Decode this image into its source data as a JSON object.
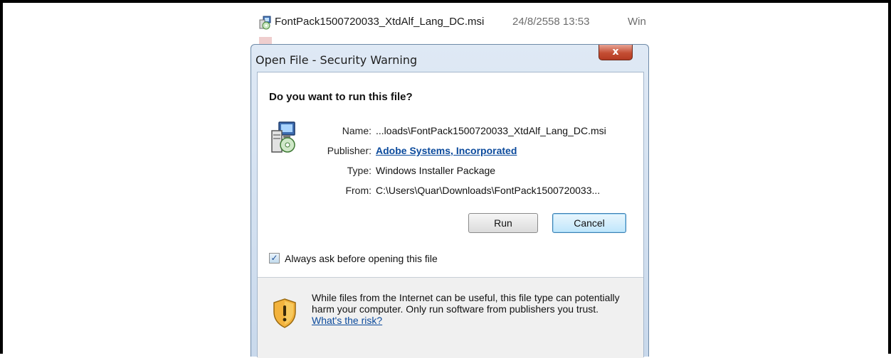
{
  "background_file": {
    "name": "FontPack1500720033_XtdAlf_Lang_DC.msi",
    "date": "24/8/2558 13:53",
    "type": "Win"
  },
  "dialog": {
    "title": "Open File - Security Warning",
    "close_glyph": "x",
    "question": "Do you want to run this file?",
    "fields": {
      "name_label": "Name:",
      "name_value": "...loads\\FontPack1500720033_XtdAlf_Lang_DC.msi",
      "publisher_label": "Publisher:",
      "publisher_value": "Adobe Systems, Incorporated",
      "type_label": "Type:",
      "type_value": "Windows Installer Package",
      "from_label": "From:",
      "from_value": "C:\\Users\\Quar\\Downloads\\FontPack1500720033..."
    },
    "run_label": "Run",
    "cancel_label": "Cancel",
    "always_ask_label": "Always ask before opening this file",
    "always_ask_checked": true,
    "check_glyph": "✓",
    "warning_text": "While files from the Internet can be useful, this file type can potentially harm your computer. Only run software from publishers you trust.",
    "risk_link": "What's the risk?"
  },
  "icons": {
    "file_icon": "installer-package-icon",
    "package_icon": "installer-package-icon",
    "warning_icon": "shield-warning-icon"
  },
  "colors": {
    "link": "#0b4a9c",
    "close_button": "#c44e34",
    "default_button_border": "#3c7fb1"
  }
}
